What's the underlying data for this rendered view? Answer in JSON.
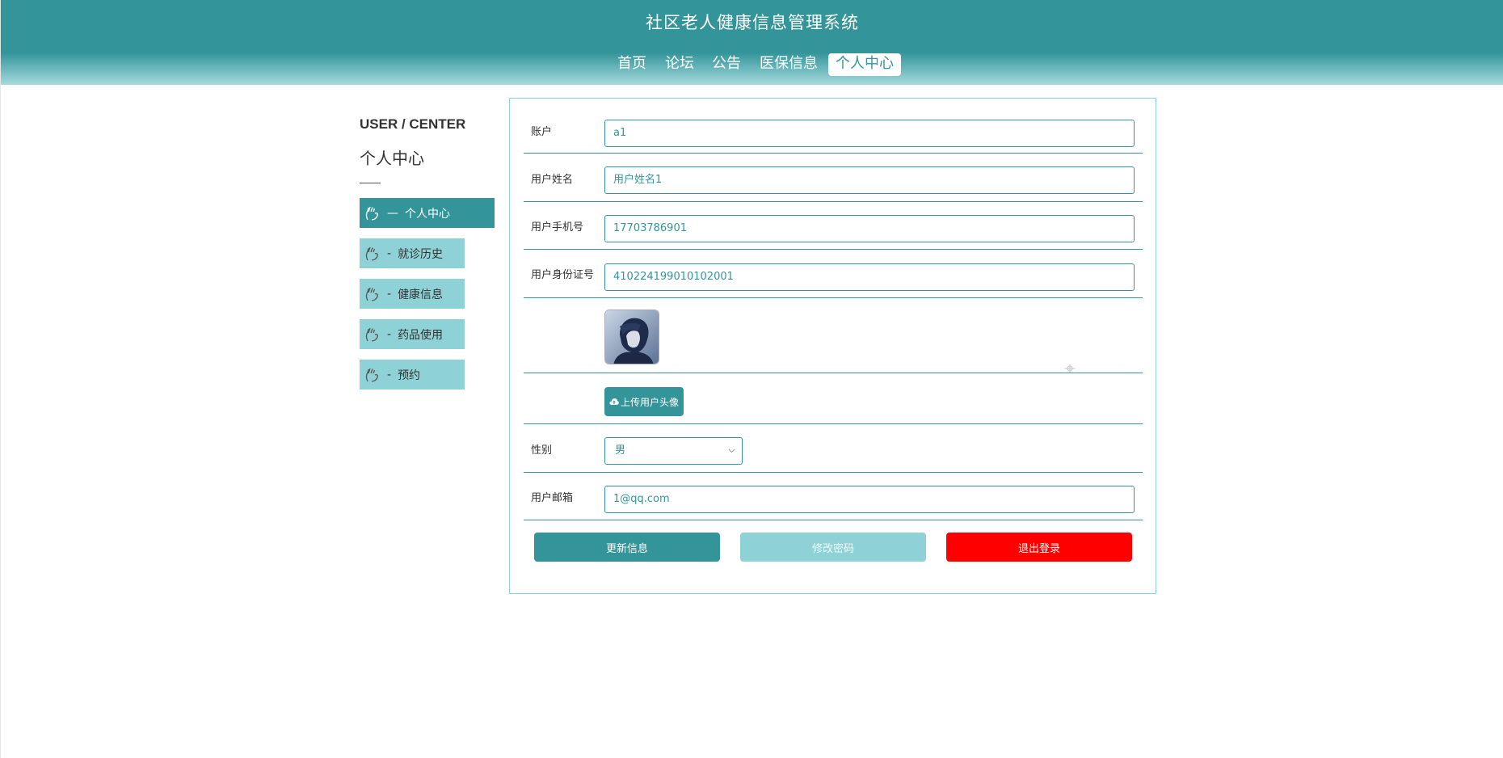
{
  "header": {
    "title": "社区老人健康信息管理系统",
    "nav": [
      "首页",
      "论坛",
      "公告",
      "医保信息",
      "个人中心"
    ],
    "active_nav": "个人中心"
  },
  "sidebar": {
    "title_en": "USER / CENTER",
    "title_cn": "个人中心",
    "items": [
      {
        "label": "个人中心",
        "dash": "—",
        "icon": "hand-icon"
      },
      {
        "label": "就诊历史",
        "dash": "-",
        "icon": "hand-icon"
      },
      {
        "label": "健康信息",
        "dash": "-",
        "icon": "hand-icon"
      },
      {
        "label": "药品使用",
        "dash": "-",
        "icon": "hand-icon"
      },
      {
        "label": "预约",
        "dash": "-",
        "icon": "hand-icon"
      }
    ]
  },
  "form": {
    "account": {
      "label": "账户",
      "value": "a1"
    },
    "name": {
      "label": "用户姓名",
      "value": "用户姓名1"
    },
    "phone": {
      "label": "用户手机号",
      "value": "17703786901"
    },
    "id_card": {
      "label": "用户身份证号",
      "value": "410224199010102001"
    },
    "upload_label": "上传用户头像",
    "gender": {
      "label": "性别",
      "value": "男"
    },
    "email": {
      "label": "用户邮箱",
      "value": "1@qq.com"
    }
  },
  "buttons": {
    "update": "更新信息",
    "change_password": "修改密码",
    "logout": "退出登录"
  },
  "colors": {
    "primary": "#33959a",
    "light": "#8ed1d6",
    "danger": "#ff0000"
  }
}
